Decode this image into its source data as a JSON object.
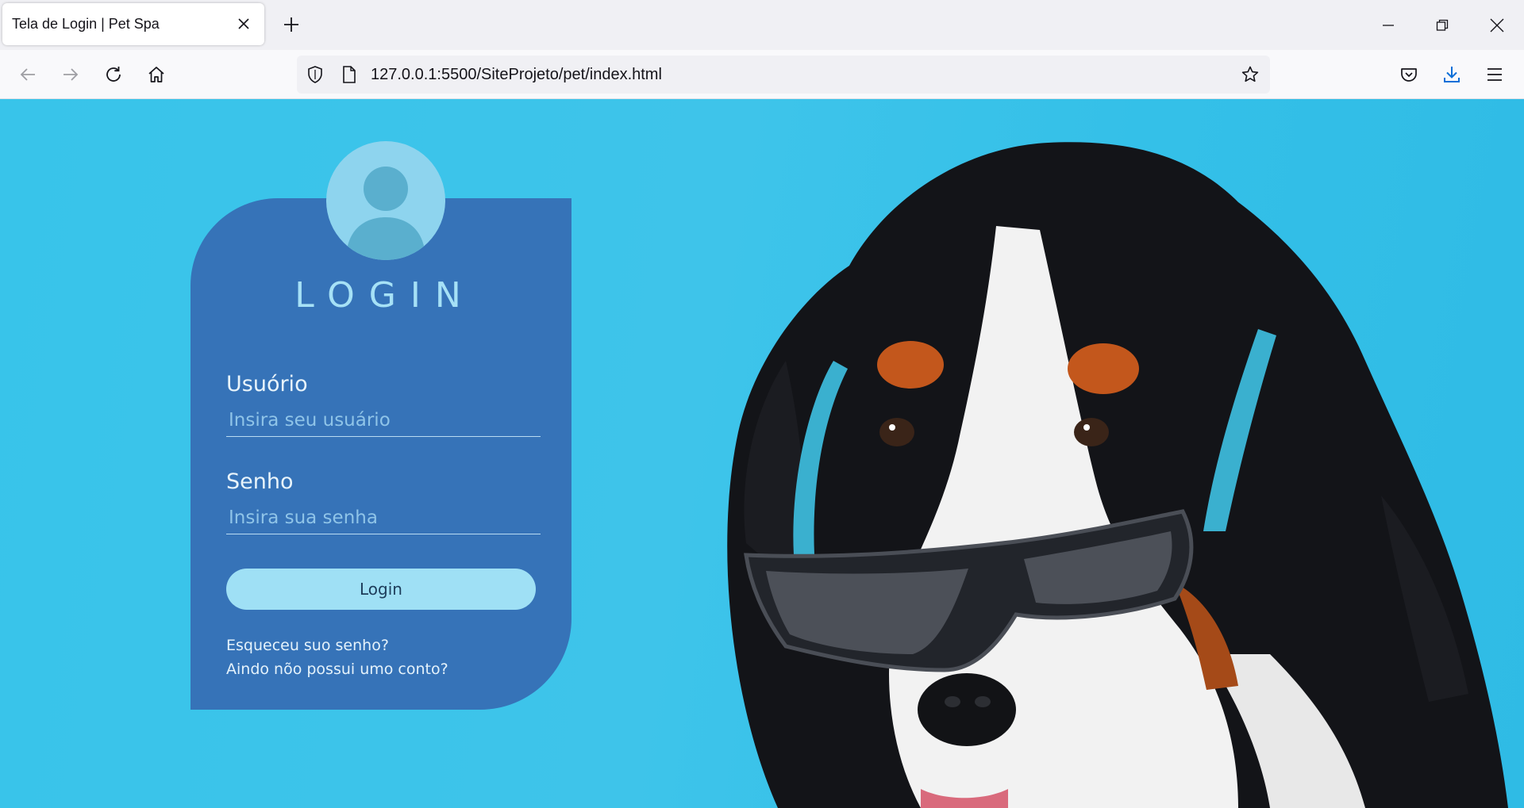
{
  "browser": {
    "tab_title": "Tela de Login | Pet Spa",
    "url": "127.0.0.1:5500/SiteProjeto/pet/index.html"
  },
  "login": {
    "title": "LOGIN",
    "user_label": "Usuório",
    "user_placeholder": "Insira seu usuário",
    "password_label": "Senho",
    "password_placeholder": "Insira sua senha",
    "button_label": "Login",
    "forgot_link": "Esqueceu suo senho?",
    "signup_link": "Aindo nõo possui umo conto?"
  },
  "colors": {
    "background": "#3ec4ea",
    "card": "#3673b8",
    "button": "#9fe0f5",
    "avatar": "#8ed4ee"
  },
  "icons": [
    "close-icon",
    "plus-icon",
    "minimize-icon",
    "restore-icon",
    "back-icon",
    "forward-icon",
    "reload-icon",
    "home-icon",
    "shield-icon",
    "page-icon",
    "star-icon",
    "pocket-icon",
    "download-icon",
    "menu-icon",
    "user-avatar-icon"
  ]
}
